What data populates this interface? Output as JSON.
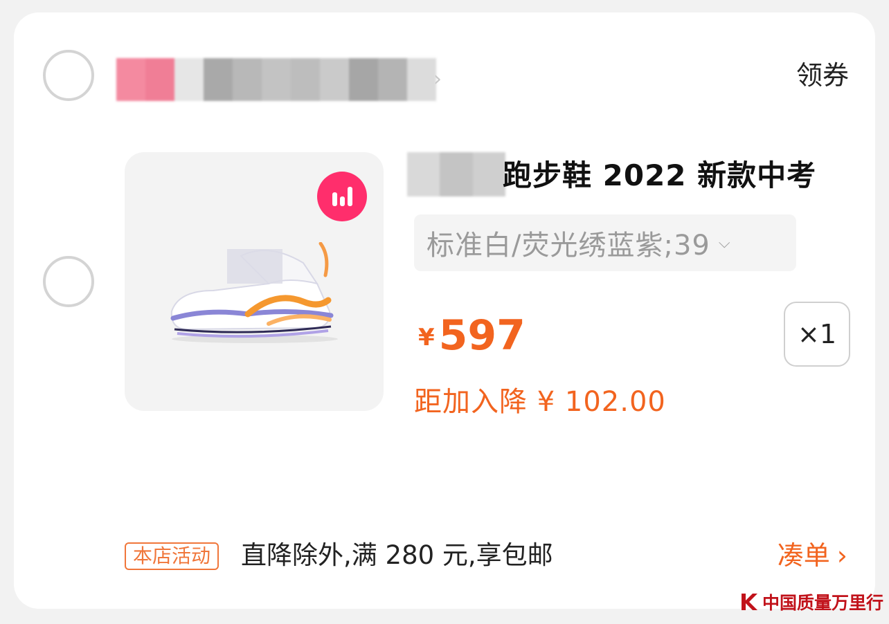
{
  "store": {
    "coupon_label": "领券"
  },
  "product": {
    "title_visible": "跑步鞋 2022 新款中考",
    "sku": "标准白/荧光绣蓝紫;39",
    "currency": "¥",
    "price": "597",
    "quantity": "×1",
    "price_drop": "距加入降 ¥ 102.00"
  },
  "promo": {
    "tag": "本店活动",
    "text": "直降除外,满 280 元,享包邮",
    "add_on_label": "凑单"
  },
  "watermark": {
    "text": "中国质量万里行"
  },
  "icons": {
    "store_chevron": "chevron-right-icon",
    "sku_chevron": "chevron-down-icon",
    "add_on_chevron": "chevron-right-icon",
    "badge": "bar-chart-icon",
    "watermark_logo": "k-logo-icon"
  },
  "colors": {
    "accent": "#f2641f",
    "badge": "#ff2e6c",
    "watermark": "#c1121a"
  }
}
